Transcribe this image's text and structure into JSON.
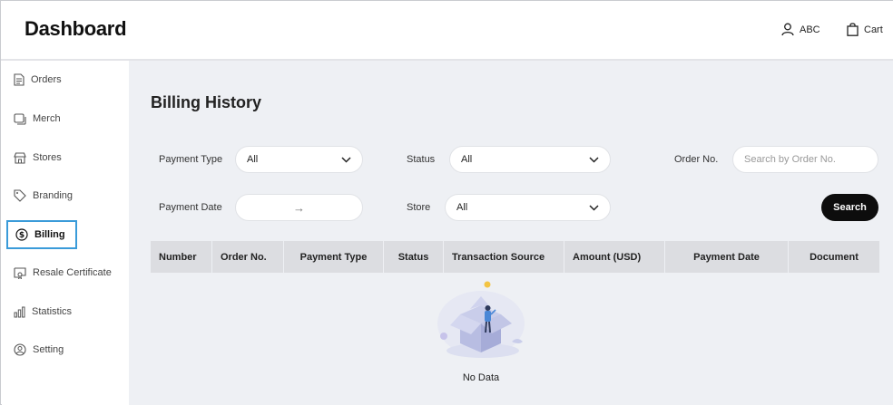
{
  "header": {
    "brand": "Dashboard",
    "user_label": "ABC",
    "cart_label": "Cart"
  },
  "sidebar": {
    "items": [
      {
        "label": "Orders",
        "icon": "document-icon"
      },
      {
        "label": "Merch",
        "icon": "merch-icon"
      },
      {
        "label": "Stores",
        "icon": "store-icon"
      },
      {
        "label": "Branding",
        "icon": "tag-icon"
      },
      {
        "label": "Billing",
        "icon": "dollar-circle-icon",
        "active": true
      },
      {
        "label": "Resale Certificate",
        "icon": "certificate-icon"
      },
      {
        "label": "Statistics",
        "icon": "bar-chart-icon"
      },
      {
        "label": "Setting",
        "icon": "user-circle-icon"
      }
    ]
  },
  "main": {
    "title": "Billing History",
    "filters": {
      "payment_type_label": "Payment Type",
      "payment_type_value": "All",
      "status_label": "Status",
      "status_value": "All",
      "order_no_label": "Order No.",
      "order_no_placeholder": "Search by Order No.",
      "payment_date_label": "Payment Date",
      "payment_date_separator": "→",
      "store_label": "Store",
      "store_value": "All",
      "search_button": "Search"
    },
    "table": {
      "columns": [
        "Number",
        "Order No.",
        "Payment Type",
        "Status",
        "Transaction Source",
        "Amount (USD)",
        "Payment Date",
        "Document"
      ],
      "rows": [],
      "empty_text": "No Data"
    }
  },
  "colors": {
    "accent_border": "#3a9bd9",
    "main_bg": "#eef0f4",
    "table_header_bg": "#dcdde1",
    "button_bg": "#0d0d0d"
  }
}
